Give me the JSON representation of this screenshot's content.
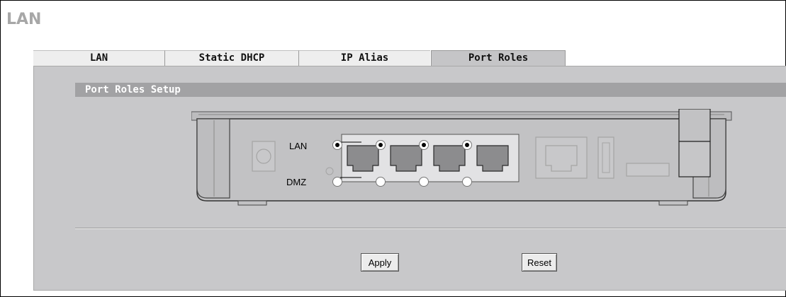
{
  "page": {
    "title": "LAN"
  },
  "tabs": [
    {
      "label": "LAN",
      "active": false
    },
    {
      "label": "Static DHCP",
      "active": false
    },
    {
      "label": "IP Alias",
      "active": false
    },
    {
      "label": "Port Roles",
      "active": true
    }
  ],
  "section": {
    "title": "Port Roles Setup"
  },
  "ports": {
    "lan_label": "LAN",
    "dmz_label": "DMZ",
    "roles": [
      "LAN",
      "LAN",
      "LAN",
      "LAN"
    ]
  },
  "buttons": {
    "apply": "Apply",
    "reset": "Reset"
  },
  "colors": {
    "panel": "#c8c8ca",
    "section_bar": "#a2a2a4",
    "tab_inactive": "#eeeeee",
    "tab_active": "#c5c5c7",
    "title": "#a7a7a7"
  }
}
